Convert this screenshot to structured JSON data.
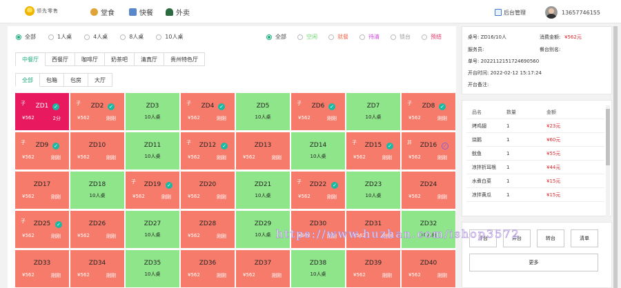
{
  "header": {
    "logo_text": "领先零售",
    "nav": [
      {
        "label": "堂食",
        "icon": "dining-icon",
        "color": "#e0a33a"
      },
      {
        "label": "快餐",
        "icon": "fast-food-icon",
        "color": "#5a87c9"
      },
      {
        "label": "外卖",
        "icon": "delivery-icon",
        "color": "#2c6a3f"
      }
    ],
    "admin_label": "后台管理",
    "user_phone": "13657746155"
  },
  "filters": {
    "size": [
      "全部",
      "1人桌",
      "4人桌",
      "8人桌",
      "10人桌"
    ],
    "status": [
      {
        "label": "全部",
        "color": "#333333"
      },
      {
        "label": "空闲",
        "color": "#6fd36a"
      },
      {
        "label": "就餐",
        "color": "#f06a50"
      },
      {
        "label": "待清",
        "color": "#d04ae0"
      },
      {
        "label": "锁台",
        "color": "#9a9a9a"
      },
      {
        "label": "预结",
        "color": "#e03a6a"
      }
    ]
  },
  "halls": [
    "中餐厅",
    "西餐厅",
    "咖啡厅",
    "奶茶吧",
    "清真厅",
    "贵州特色厅"
  ],
  "areas": [
    "全部",
    "包箱",
    "包房",
    "大厅"
  ],
  "tables": [
    {
      "name": "ZD1",
      "state": "active",
      "price": "¥562",
      "status": "2分",
      "tag": "子",
      "check": "teal"
    },
    {
      "name": "ZD2",
      "state": "red",
      "price": "¥562",
      "status": "刚刚",
      "tag": "子",
      "check": "teal"
    },
    {
      "name": "ZD3",
      "state": "green",
      "sub": "10人桌"
    },
    {
      "name": "ZD4",
      "state": "red",
      "price": "¥562",
      "status": "刚刚",
      "tag": "子",
      "check": "teal"
    },
    {
      "name": "ZD5",
      "state": "green",
      "sub": "10人桌"
    },
    {
      "name": "ZD6",
      "state": "red",
      "price": "¥562",
      "status": "刚刚",
      "tag": "子",
      "check": "teal"
    },
    {
      "name": "ZD7",
      "state": "green",
      "sub": "10人桌"
    },
    {
      "name": "ZD8",
      "state": "red",
      "price": "¥562",
      "status": "刚刚",
      "tag": "子",
      "check": "teal"
    },
    {
      "name": "ZD9",
      "state": "red",
      "price": "¥562",
      "status": "刚刚",
      "tag": "子",
      "check": "teal"
    },
    {
      "name": "ZD10",
      "state": "red",
      "price": "¥562",
      "status": "刚刚"
    },
    {
      "name": "ZD11",
      "state": "green",
      "sub": "10人桌"
    },
    {
      "name": "ZD12",
      "state": "red",
      "price": "¥562",
      "status": "刚刚",
      "tag": "子",
      "check": "teal"
    },
    {
      "name": "ZD13",
      "state": "red",
      "price": "¥562",
      "status": "刚刚"
    },
    {
      "name": "ZD14",
      "state": "green",
      "sub": "10人桌"
    },
    {
      "name": "ZD15",
      "state": "red",
      "price": "¥562",
      "status": "刚刚",
      "tag": "子",
      "check": "teal"
    },
    {
      "name": "ZD16",
      "state": "red",
      "price": "¥562",
      "status": "刚刚",
      "tag": "并",
      "check": "purple"
    },
    {
      "name": "ZD17",
      "state": "red",
      "price": "¥562",
      "status": "刚刚"
    },
    {
      "name": "ZD18",
      "state": "green",
      "sub": "10人桌"
    },
    {
      "name": "ZD19",
      "state": "red",
      "price": "¥562",
      "status": "刚刚",
      "tag": "子",
      "check": "teal"
    },
    {
      "name": "ZD20",
      "state": "red",
      "price": "¥562",
      "status": "刚刚"
    },
    {
      "name": "ZD21",
      "state": "green",
      "sub": "10人桌"
    },
    {
      "name": "ZD22",
      "state": "red",
      "price": "¥562",
      "status": "刚刚",
      "tag": "子",
      "check": "teal"
    },
    {
      "name": "ZD23",
      "state": "green",
      "sub": "10人桌"
    },
    {
      "name": "ZD24",
      "state": "red",
      "price": "¥562",
      "status": "刚刚"
    },
    {
      "name": "ZD25",
      "state": "red",
      "price": "¥562",
      "status": "刚刚",
      "tag": "子",
      "check": "teal"
    },
    {
      "name": "ZD26",
      "state": "red",
      "price": "¥562",
      "status": "刚刚"
    },
    {
      "name": "ZD27",
      "state": "green",
      "sub": "10人桌"
    },
    {
      "name": "ZD28",
      "state": "red",
      "price": "¥562",
      "status": "刚刚"
    },
    {
      "name": "ZD29",
      "state": "green",
      "sub": "10人桌"
    },
    {
      "name": "ZD30",
      "state": "red",
      "price": "¥562",
      "status": "刚刚"
    },
    {
      "name": "ZD31",
      "state": "red",
      "price": "¥562",
      "status": "刚刚"
    },
    {
      "name": "ZD32",
      "state": "green",
      "sub": "10人桌"
    },
    {
      "name": "ZD33",
      "state": "red",
      "price": "¥562",
      "status": "刚刚"
    },
    {
      "name": "ZD34",
      "state": "red",
      "price": "¥562",
      "status": "刚刚"
    },
    {
      "name": "ZD35",
      "state": "green",
      "sub": "10人桌"
    },
    {
      "name": "ZD36",
      "state": "red",
      "price": "¥562",
      "status": "刚刚"
    },
    {
      "name": "ZD37",
      "state": "red",
      "price": "¥562",
      "status": "刚刚"
    },
    {
      "name": "ZD38",
      "state": "green",
      "sub": "10人桌"
    },
    {
      "name": "ZD39",
      "state": "red",
      "price": "¥562",
      "status": "刚刚"
    },
    {
      "name": "ZD40",
      "state": "red",
      "price": "¥562",
      "status": "刚刚"
    }
  ],
  "info": {
    "table_label": "桌号: ZD16/10人",
    "amount_label": "消费金额:",
    "amount_value": "¥562元",
    "waiter_label": "服务员:",
    "alias_label": "餐台别名:",
    "order_no": "单号: 20221121517246905​60",
    "open_time": "开台时间: 2022-02-12 15:17:24",
    "remark_label": "开台备注:"
  },
  "orders": {
    "headers": [
      "品名",
      "数量",
      "金额"
    ],
    "rows": [
      {
        "name": "烤鸡翅",
        "qty": "1",
        "amount": "¥23元"
      },
      {
        "name": "烧鹅",
        "qty": "1",
        "amount": "¥60元"
      },
      {
        "name": "鱿鱼",
        "qty": "1",
        "amount": "¥55元"
      },
      {
        "name": "凉拌折耳根",
        "qty": "1",
        "amount": "¥44元"
      },
      {
        "name": "水煮白菜",
        "qty": "1",
        "amount": "¥15元"
      },
      {
        "name": "凉拌黄瓜",
        "qty": "1",
        "amount": "¥15元"
      }
    ]
  },
  "actions": {
    "btn1": "开台",
    "btn2": "并台",
    "btn3": "转台",
    "btn4": "清单",
    "more": "更多"
  },
  "watermark": "https://www.huzhan.com/ishop3572"
}
